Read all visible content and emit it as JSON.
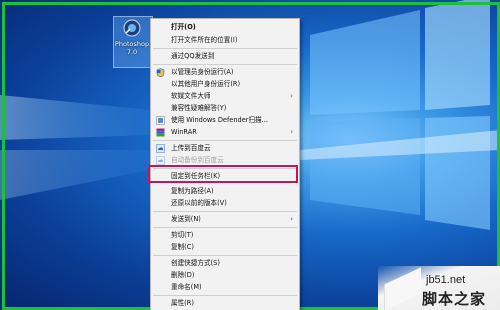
{
  "desktop": {
    "icon_label": "Photoshop 7.0",
    "icon_name": "photoshop-icon"
  },
  "context_menu": {
    "items": [
      {
        "label": "打开(O)",
        "icon": "",
        "bold": true
      },
      {
        "label": "打开文件所在的位置(I)",
        "icon": ""
      },
      {
        "label": "通过QQ发送到",
        "icon": ""
      },
      {
        "label": "以管理员身份运行(A)",
        "icon": "shield-icon"
      },
      {
        "label": "以其他用户身份运行(R)",
        "icon": ""
      },
      {
        "label": "软媒文件大师",
        "icon": "",
        "submenu": true
      },
      {
        "label": "兼容性疑难解答(Y)",
        "icon": ""
      },
      {
        "label": "使用 Windows Defender扫描...",
        "icon": "defender-icon"
      },
      {
        "label": "WinRAR",
        "icon": "winrar-icon",
        "submenu": true
      },
      {
        "label": "上传到百度云",
        "icon": "baidu-cloud-icon"
      },
      {
        "label": "自动备份到百度云",
        "icon": "baidu-cloud-icon",
        "disabled": true
      },
      {
        "label": "固定到任务栏(K)",
        "icon": "",
        "highlighted": true
      },
      {
        "label": "复制为路径(A)",
        "icon": ""
      },
      {
        "label": "还原以前的版本(V)",
        "icon": ""
      },
      {
        "label": "发送到(N)",
        "icon": "",
        "submenu": true
      },
      {
        "label": "剪切(T)",
        "icon": ""
      },
      {
        "label": "复制(C)",
        "icon": ""
      },
      {
        "label": "创建快捷方式(S)",
        "icon": ""
      },
      {
        "label": "删除(D)",
        "icon": ""
      },
      {
        "label": "重命名(M)",
        "icon": ""
      },
      {
        "label": "属性(R)",
        "icon": ""
      }
    ],
    "highlight_color": "#c2185b"
  },
  "watermark": {
    "site": "jb51.net",
    "name": "脚本之家"
  },
  "colors": {
    "frame": "#1fbf3b",
    "menu_bg": "#f2f2f2"
  }
}
